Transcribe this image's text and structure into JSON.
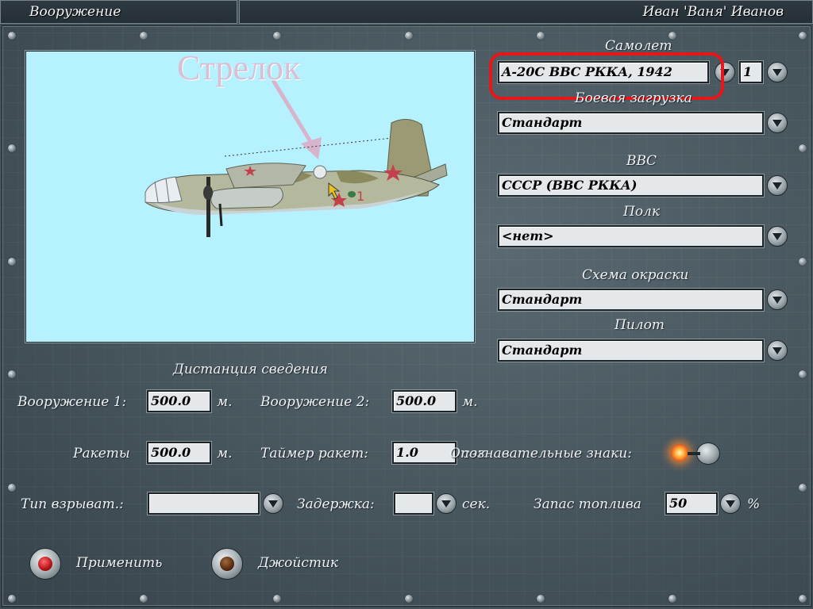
{
  "header": {
    "screen_title": "Вооружение",
    "player_name": "Иван 'Ваня' Иванов"
  },
  "preview": {
    "gunner_label": "Стрелок"
  },
  "aircraft": {
    "label": "Самолет",
    "value": "A-20C ВВС РККА, 1942",
    "slot": "1"
  },
  "loadout": {
    "label": "Боевая загрузка",
    "value": "Стандарт"
  },
  "air_force": {
    "label": "ВВС",
    "value": "СССР (ВВС РККА)"
  },
  "regiment": {
    "label": "Полк",
    "value": "<нет>"
  },
  "skin": {
    "label": "Схема окраски",
    "value": "Стандарт"
  },
  "pilot": {
    "label": "Пилот",
    "value": "Стандарт"
  },
  "convergence": {
    "title": "Дистанция сведения",
    "weapon1_label": "Вооружение 1:",
    "weapon1_value": "500.0",
    "weapon1_unit": "м.",
    "weapon2_label": "Вооружение 2:",
    "weapon2_value": "500.0",
    "weapon2_unit": "м.",
    "rockets_label": "Ракеты",
    "rockets_value": "500.0",
    "rockets_unit": "м.",
    "rocket_timer_label": "Таймер ракет:",
    "rocket_timer_value": "1.0",
    "rocket_timer_unit": "сек.",
    "markings_label": "Опознавательные знаки:"
  },
  "fuze": {
    "type_label": "Тип взрыват.:",
    "type_value": "",
    "delay_label": "Задержка:",
    "delay_value": "",
    "delay_unit": "сек.",
    "fuel_label": "Запас топлива",
    "fuel_value": "50",
    "fuel_unit": "%"
  },
  "actions": {
    "apply_label": "Применить",
    "joystick_label": "Джойстик"
  },
  "colors": {
    "preview_bg": "#b6f1ff",
    "highlight": "#e8161a",
    "apply_button_core": "#b51218",
    "joystick_button_core": "#5a2a10",
    "markings_lamp": "#ff9a2e"
  }
}
